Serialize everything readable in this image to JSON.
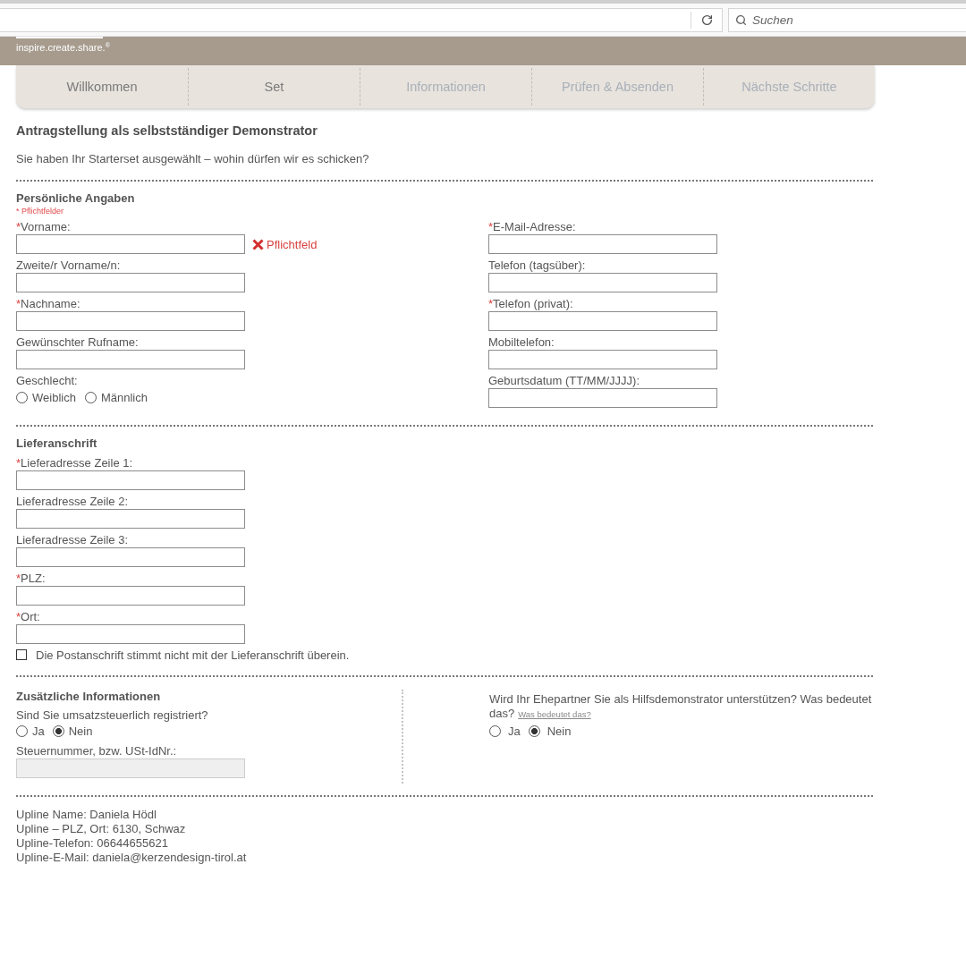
{
  "browser": {
    "search_placeholder": "Suchen"
  },
  "header": {
    "tagline": "inspire.create.share.$^{®}$"
  },
  "steps": [
    {
      "label": "Willkommen",
      "disabled": false
    },
    {
      "label": "Set",
      "disabled": false
    },
    {
      "label": "Informationen",
      "disabled": true
    },
    {
      "label": "Prüfen & Absenden",
      "disabled": true
    },
    {
      "label": "Nächste Schritte",
      "disabled": true
    }
  ],
  "title": "Antragstellung als selbstständiger Demonstrator",
  "intro": "Sie haben Ihr Starterset ausgewählt – wohin dürfen wir es schicken?",
  "personal": {
    "heading": "Persönliche Angaben",
    "required_note": "* Pflichtfelder",
    "left_fields": [
      {
        "mark": "*",
        "label": "Vorname:",
        "error": "Pflichtfeld"
      },
      {
        "label": "Zweite/r Vorname/n:"
      },
      {
        "mark": "*",
        "label": "Nachname:"
      },
      {
        "label": "Gewünschter Rufname:"
      }
    ],
    "gender": {
      "label": "Geschlecht:",
      "options": [
        {
          "label": "Weiblich",
          "selected": false
        },
        {
          "label": "Männlich",
          "selected": false
        }
      ]
    },
    "right_fields": [
      {
        "mark": "*",
        "label": "E-Mail-Adresse:"
      },
      {
        "label": "Telefon (tagsüber):"
      },
      {
        "mark": "*",
        "label": "Telefon (privat):"
      },
      {
        "label": "Mobiltelefon:"
      },
      {
        "label": "Geburtsdatum (TT/MM/JJJJ):"
      }
    ]
  },
  "delivery": {
    "heading": "Lieferanschrift",
    "fields": [
      {
        "mark": "*",
        "label": "Lieferadresse Zeile 1:"
      },
      {
        "label": "Lieferadresse Zeile 2:"
      },
      {
        "label": "Lieferadresse Zeile 3:"
      },
      {
        "mark": "*",
        "label": "PLZ:"
      },
      {
        "mark": "*",
        "label": "Ort:"
      }
    ],
    "postal_checkbox": {
      "label": "Die Postanschrift stimmt nicht mit der Lieferanschrift überein.",
      "checked": false
    }
  },
  "additional": {
    "heading": "Zusätzliche Informationen",
    "vat_question": "Sind Sie umsatzsteuerlich registriert?",
    "vat_options": [
      {
        "label": "Ja",
        "selected": false
      },
      {
        "label": "Nein",
        "selected": true
      }
    ],
    "tax_field": {
      "label": "Steuernummer, bzw. USt-IdNr.:",
      "disabled": true
    },
    "partner_question": "Wird Ihr Ehepartner Sie als Hilfsdemonstrator unterstützen? Was bedeutet das?",
    "partner_link": "Was bedeutet das?",
    "partner_options": [
      {
        "label": "Ja",
        "selected": false
      },
      {
        "label": "Nein",
        "selected": true
      }
    ]
  },
  "upline": [
    "Upline Name: Daniela Hödl",
    "Upline – PLZ, Ort: 6130, Schwaz",
    "Upline-Telefon: 06644655621",
    "Upline-E-Mail: daniela@kerzendesign-tirol.at"
  ]
}
